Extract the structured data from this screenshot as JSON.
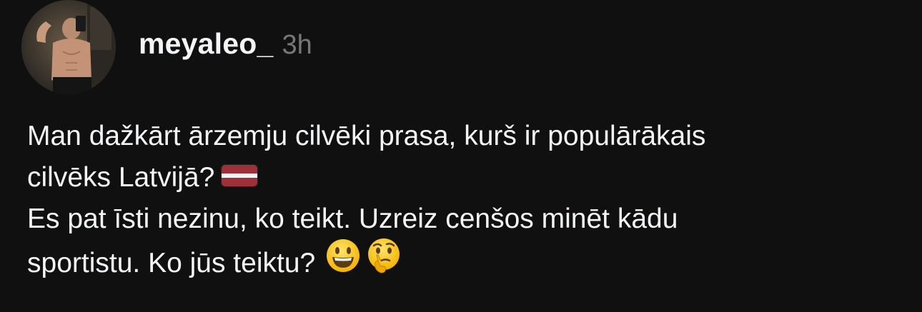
{
  "post": {
    "username": "meyaleo_",
    "time": "3h",
    "lines": [
      "Man dažkārt ārzemju cilvēki prasa, kurš ir populārākais",
      "cilvēks Latvijā?",
      "Es pat īsti nezinu, ko teikt. Uzreiz cenšos minēt kādu",
      "sportistu. Ko jūs teiktu?"
    ],
    "emojis": [
      "latvia-flag",
      "grinning-face",
      "thinking-face"
    ]
  },
  "colors": {
    "background": "#101010",
    "text": "#f3f5f7",
    "secondary": "#777777",
    "flag_red": "#9e3039"
  }
}
